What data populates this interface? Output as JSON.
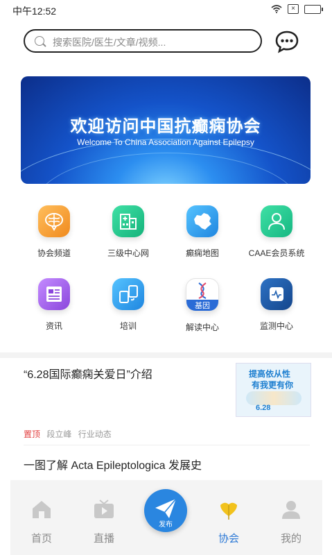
{
  "status_bar": {
    "time": "中午12:52"
  },
  "search": {
    "placeholder": "搜索医院/医生/文章/视频..."
  },
  "banner": {
    "title": "欢迎访问中国抗癫痫协会",
    "subtitle": "Welcome To China  Association Against Epilepsy"
  },
  "grid": {
    "items": [
      {
        "label": "协会频道",
        "icon": "brain-icon",
        "color": "#f6a03a"
      },
      {
        "label": "三级中心网",
        "icon": "hospital-icon",
        "color": "#22c28a"
      },
      {
        "label": "癫痫地图",
        "icon": "china-map-icon",
        "color": "#2f9bea"
      },
      {
        "label": "CAAE会员系统",
        "icon": "member-icon",
        "color": "#24c48e"
      },
      {
        "label": "资讯",
        "icon": "newspaper-icon",
        "color": "#9a5be0"
      },
      {
        "label": "培训",
        "icon": "devices-icon",
        "color": "#2e9be6"
      },
      {
        "label": "解读中心",
        "icon": "dna-icon",
        "color": "#2a6bd6",
        "badge": "基因"
      },
      {
        "label": "监测中心",
        "icon": "monitor-icon",
        "color": "#1e5fb0"
      }
    ]
  },
  "news": [
    {
      "title": "“6.28国际癫痫关爱日”介绍"
    },
    {
      "title": "一图了解 Acta Epileptologica 发展史"
    }
  ],
  "meta": {
    "top": "置顶",
    "author": "段立峰",
    "category": "行业动态"
  },
  "thumb": {
    "line1": "提高依从性",
    "line2": "有我更有你",
    "date": "6.28"
  },
  "tabbar": {
    "tabs": [
      {
        "label": "首页",
        "icon": "home-icon"
      },
      {
        "label": "直播",
        "icon": "tv-icon"
      },
      {
        "label": "协会",
        "icon": "ginkgo-icon",
        "active": true
      },
      {
        "label": "我的",
        "icon": "user-icon"
      }
    ],
    "publish_label": "发布"
  },
  "colors": {
    "accent": "#2e7ad6",
    "top_tag": "#e23c3c"
  }
}
